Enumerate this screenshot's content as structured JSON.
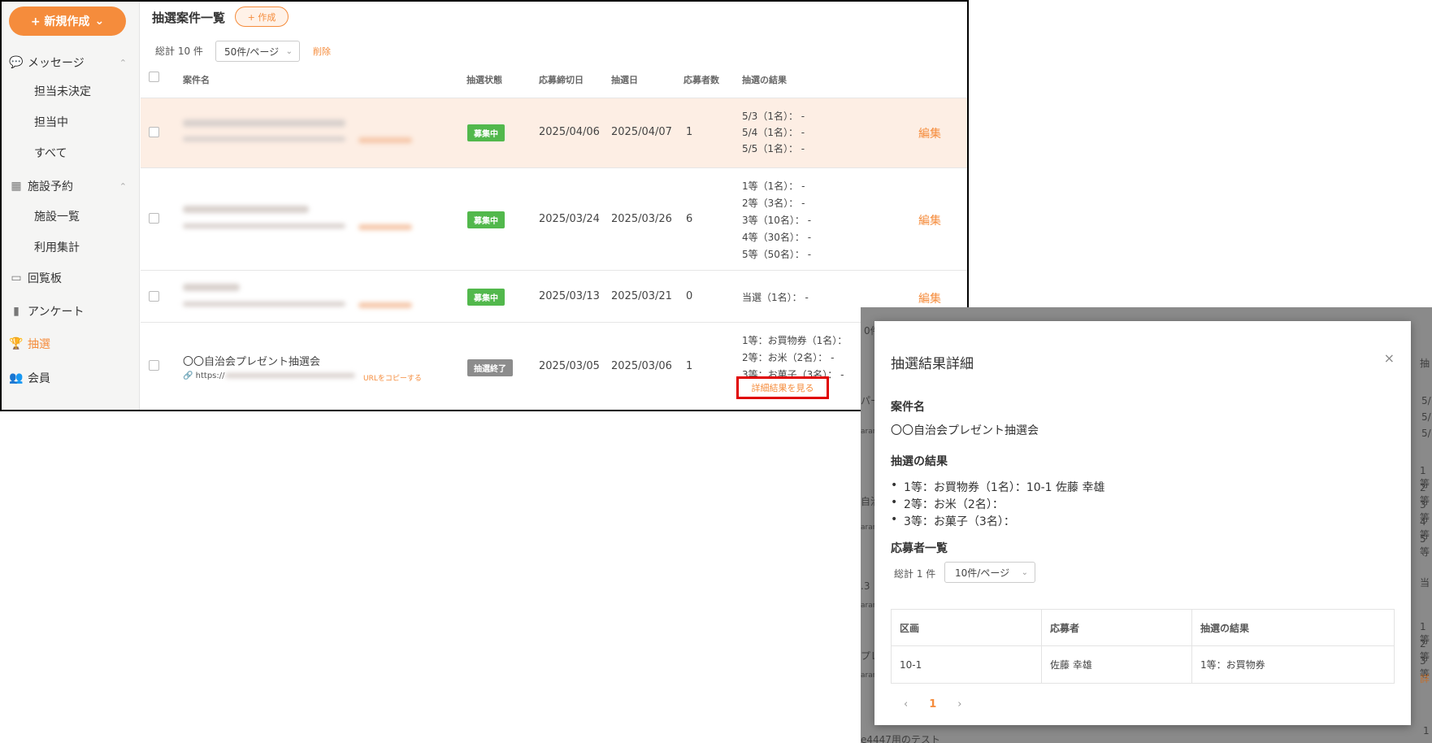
{
  "sidebar": {
    "new_button": "+ 新規作成",
    "items": [
      {
        "label": "メッセージ"
      },
      {
        "label": "担当未決定"
      },
      {
        "label": "担当中"
      },
      {
        "label": "すべて"
      },
      {
        "label": "施設予約"
      },
      {
        "label": "施設一覧"
      },
      {
        "label": "利用集計"
      },
      {
        "label": "回覧板"
      },
      {
        "label": "アンケート"
      },
      {
        "label": "抽選"
      },
      {
        "label": "会員"
      }
    ]
  },
  "main": {
    "title": "抽選案件一覧",
    "create_label": "+ 作成",
    "total": "総計 10 件",
    "page_size": "50件/ページ",
    "delete_label": "削除",
    "columns": [
      "案件名",
      "抽選状態",
      "応募締切日",
      "抽選日",
      "応募者数",
      "抽選の結果"
    ],
    "rows": [
      {
        "status": "募集中",
        "deadline": "2025/04/06",
        "draw_date": "2025/04/07",
        "applicants": "1",
        "results": [
          "5/3（1名）： -",
          "5/4（1名）： -",
          "5/5（1名）： -"
        ],
        "edit": "編集"
      },
      {
        "status": "募集中",
        "deadline": "2025/03/24",
        "draw_date": "2025/03/26",
        "applicants": "6",
        "results": [
          "1等（1名）： -",
          "2等（3名）： -",
          "3等（10名）： -",
          "4等（30名）： -",
          "5等（50名）： -"
        ],
        "edit": "編集"
      },
      {
        "status": "募集中",
        "deadline": "2025/03/13",
        "draw_date": "2025/03/21",
        "applicants": "0",
        "results": [
          "当選（1名）： -"
        ],
        "edit": "編集"
      },
      {
        "name": "〇〇自治会プレゼント抽選会",
        "url_prefix": "https://",
        "copy_url": "URLをコピーする",
        "status": "抽選終了",
        "deadline": "2025/03/05",
        "draw_date": "2025/03/06",
        "applicants": "1",
        "results": [
          "1等：お買物券（1名）：",
          "2等：お米（2名）： -",
          "3等：お菓子（3名）： -"
        ],
        "detail_link": "詳細結果を見る"
      }
    ]
  },
  "modal": {
    "title": "抽選結果詳細",
    "close": "×",
    "case_label": "案件名",
    "case_name": "〇〇自治会プレゼント抽選会",
    "result_label": "抽選の結果",
    "results": [
      "1等：お買物券（1名）：10-1 佐藤 幸雄",
      "2等：お米（2名）：",
      "3等：お菓子（3名）："
    ],
    "applicants_label": "応募者一覧",
    "total": "総計 1 件",
    "page_size": "10件/ページ",
    "table_headers": [
      "区画",
      "応募者",
      "抽選の結果"
    ],
    "table_rows": [
      [
        "10-1",
        "佐藤 幸雄",
        "1等：お買物券"
      ]
    ],
    "pager_prev": "‹",
    "pager_current": "1",
    "pager_next": "›"
  },
  "background_fragments": {
    "right": [
      "抽",
      "5/",
      "5/",
      "5/",
      "1等",
      "2等",
      "3等",
      "4等",
      "5等",
      "当",
      "1等",
      "2等",
      "3等",
      "詳",
      "1"
    ],
    "left": [
      "0件",
      "パー",
      "aran",
      "自治",
      "aran",
      ".3",
      "aran",
      "プレ",
      "aran"
    ],
    "bottom": "e4447用のテスト"
  },
  "colors": {
    "accent": "#f58c3c",
    "status_open": "#52b84c",
    "status_closed": "#8c8c8c",
    "highlight_box": "#e00000"
  }
}
